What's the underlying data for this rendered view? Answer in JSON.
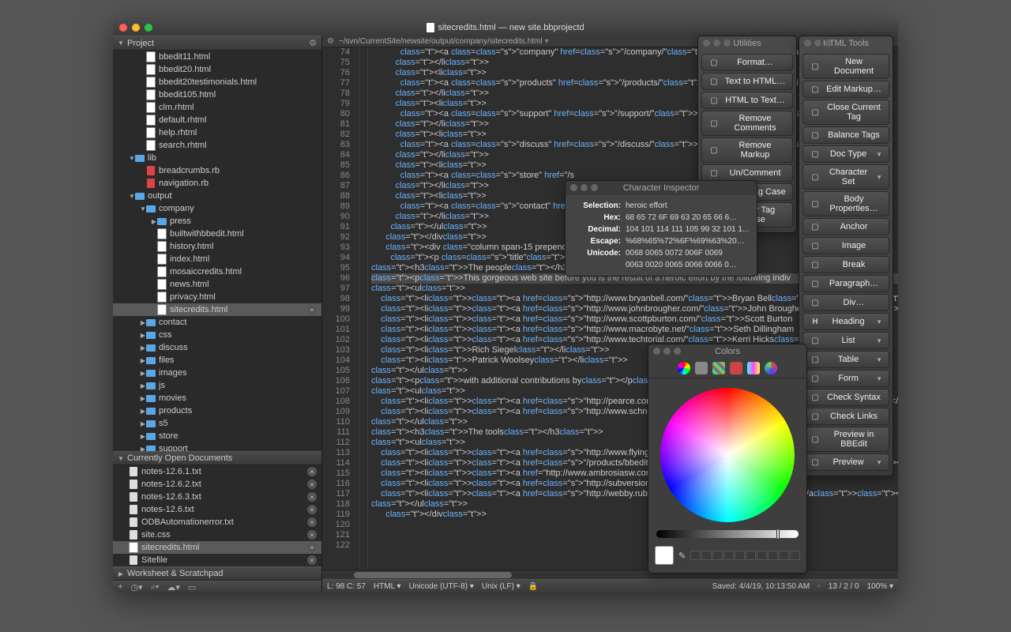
{
  "window": {
    "title": "sitecredits.html — new site.bbprojectd",
    "path": "~/svn/CurrentSite/newsite/output/company/sitecredits.html"
  },
  "sidebar": {
    "project_label": "Project",
    "open_docs_label": "Currently Open Documents",
    "worksheet_label": "Worksheet & Scratchpad",
    "project_tree": [
      {
        "name": "bbedit11.html",
        "icon": "html",
        "indent": 2
      },
      {
        "name": "bbedit20.html",
        "icon": "html",
        "indent": 2
      },
      {
        "name": "bbedit20testimonials.html",
        "icon": "html",
        "indent": 2
      },
      {
        "name": "bbedit105.html",
        "icon": "html",
        "indent": 2
      },
      {
        "name": "clm.rhtml",
        "icon": "html",
        "indent": 2
      },
      {
        "name": "default.rhtml",
        "icon": "html",
        "indent": 2
      },
      {
        "name": "help.rhtml",
        "icon": "html",
        "indent": 2
      },
      {
        "name": "search.rhtml",
        "icon": "html",
        "indent": 2
      },
      {
        "name": "lib",
        "icon": "folder",
        "indent": 1,
        "expand": "down"
      },
      {
        "name": "breadcrumbs.rb",
        "icon": "rb",
        "indent": 2
      },
      {
        "name": "navigation.rb",
        "icon": "rb",
        "indent": 2
      },
      {
        "name": "output",
        "icon": "folder",
        "indent": 1,
        "expand": "down"
      },
      {
        "name": "company",
        "icon": "folder",
        "indent": 2,
        "expand": "down"
      },
      {
        "name": "press",
        "icon": "folder",
        "indent": 3,
        "expand": "right"
      },
      {
        "name": "builtwithbbedit.html",
        "icon": "html",
        "indent": 3
      },
      {
        "name": "history.html",
        "icon": "html",
        "indent": 3
      },
      {
        "name": "index.html",
        "icon": "html",
        "indent": 3
      },
      {
        "name": "mosaiccredits.html",
        "icon": "html",
        "indent": 3
      },
      {
        "name": "news.html",
        "icon": "html",
        "indent": 3
      },
      {
        "name": "privacy.html",
        "icon": "html",
        "indent": 3
      },
      {
        "name": "sitecredits.html",
        "icon": "html",
        "indent": 3,
        "selected": true,
        "close": true
      },
      {
        "name": "contact",
        "icon": "folder",
        "indent": 2,
        "expand": "right"
      },
      {
        "name": "css",
        "icon": "folder",
        "indent": 2,
        "expand": "right"
      },
      {
        "name": "discuss",
        "icon": "folder",
        "indent": 2,
        "expand": "right"
      },
      {
        "name": "files",
        "icon": "folder",
        "indent": 2,
        "expand": "right"
      },
      {
        "name": "images",
        "icon": "folder",
        "indent": 2,
        "expand": "right"
      },
      {
        "name": "js",
        "icon": "folder",
        "indent": 2,
        "expand": "right"
      },
      {
        "name": "movies",
        "icon": "folder",
        "indent": 2,
        "expand": "right"
      },
      {
        "name": "products",
        "icon": "folder",
        "indent": 2,
        "expand": "right"
      },
      {
        "name": "s5",
        "icon": "folder",
        "indent": 2,
        "expand": "right"
      },
      {
        "name": "store",
        "icon": "folder",
        "indent": 2,
        "expand": "right"
      },
      {
        "name": "support",
        "icon": "folder",
        "indent": 2,
        "expand": "right"
      }
    ],
    "open_docs": [
      {
        "name": "notes-12.6.1.txt",
        "icon": "txt",
        "close": true
      },
      {
        "name": "notes-12.6.2.txt",
        "icon": "txt",
        "close": true
      },
      {
        "name": "notes-12.6.3.txt",
        "icon": "txt",
        "close": true
      },
      {
        "name": "notes-12.6.txt",
        "icon": "txt",
        "close": true
      },
      {
        "name": "ODBAutomationerror.txt",
        "icon": "txt",
        "close": true
      },
      {
        "name": "site.css",
        "icon": "txt",
        "close": true
      },
      {
        "name": "sitecredits.html",
        "icon": "html",
        "selected": true,
        "close": true
      },
      {
        "name": "Sitefile",
        "icon": "txt",
        "close": true
      }
    ]
  },
  "editor": {
    "first_line": 74,
    "lines": [
      "            <a class=\"company\" href=\"/company/\">Company</a>",
      "          </li>",
      "          <li>",
      "            <a class=\"products\" href=\"/products/\">Products</a>",
      "          </li>",
      "          <li>",
      "            <a class=\"support\" href=\"/support/\">Support</a>",
      "          </li>",
      "          <li>",
      "            <a class=\"discuss\" href=\"/discuss/\">Discuss</a>",
      "          </li>",
      "          <li>",
      "            <a class=\"store\" href=\"/s",
      "          </li>",
      "          <li>",
      "            <a class=\"contact\" href=\"",
      "          </li>",
      "        </ul>",
      "      </div>",
      "",
      "      <div class=\"column span-15 prepend-2 f",
      "",
      "        <p class=\"title\">Web Site Credits</",
      "<h3>The people</h3>",
      "<p>This gorgeous web site before you is the result of a heroic effort by the following indiv",
      "<ul>",
      "    <li><a href=\"http://www.bryanbell.com/\">Bryan Bell</a></li>",
      "    <li><a href=\"http://www.johnbrougher.com/\">John Brougher</a></li>",
      "    <li><a href=\"http://www.scottpburton.com/\">Scott Burton",
      "    <li><a href=\"http://www.macrobyte.net/\">Seth Dillingham",
      "    <li><a href=\"http://www.techtorial.com/\">Kerri Hicks</a",
      "    <li>Rich Siegel</li>",
      "    <li>Patrick Woolsey</li>",
      "</ul>",
      "<p>with additional contributions by</p>",
      "<ul>",
      "    <li><a href=\"http://pearce.com/\">Naomi Pearce</a></li>",
      "    <li><a href=\"http://www.schneibs.com/\">Sandra Schneible",
      "</ul>",
      "<h3>The tools</h3>",
      "<ul>",
      "    <li><a href=\"http://www.flyingmeat.com/acorn/\">Acorn</a",
      "    <li><a href=\"/products/bbedit/index.html\">BBEdit</a></li",
      "    <li><a href=\"http://www.ambrosiasw.com/utilities/snapzp",
      "    <li><a href=\"http://subversion.tigris.org/\">Subversion<",
      "    <li><a href=\"http://webby.rubyforge.org/\">Webby</a></li",
      "</ul>",
      "      </div>",
      ""
    ],
    "highlight_line_index": 24
  },
  "status": {
    "cursor": "L: 98 C: 57",
    "lang": "HTML",
    "encoding": "Unicode (UTF-8)",
    "lineend": "Unix (LF)",
    "saved": "Saved: 4/4/19, 10:13:50 AM",
    "counts": "13 / 2 / 0",
    "zoom": "100%"
  },
  "utilities": {
    "title": "Utilities",
    "items": [
      {
        "label": "Format…",
        "icon": "gear"
      },
      {
        "label": "Text to HTML…",
        "icon": "doc"
      },
      {
        "label": "HTML to Text…",
        "icon": "doc"
      },
      {
        "label": "Remove Comments",
        "icon": "comment"
      },
      {
        "label": "Remove Markup",
        "icon": "tag"
      },
      {
        "label": "Un/Comment",
        "icon": "comment"
      },
      {
        "label": "Raise Tag Case",
        "icon": "case"
      },
      {
        "label": "Lower Tag Case",
        "icon": "case"
      }
    ]
  },
  "htmltools": {
    "title": "HTML Tools",
    "items": [
      {
        "label": "New Document",
        "icon": "doc"
      },
      {
        "label": "Edit Markup…",
        "icon": "pencil"
      },
      {
        "label": "Close Current Tag",
        "icon": "tag"
      },
      {
        "label": "Balance Tags",
        "icon": "balance"
      },
      {
        "label": "Doc Type",
        "icon": "doc",
        "menu": true
      },
      {
        "label": "Character Set",
        "icon": "char",
        "menu": true
      },
      {
        "label": "Body Properties…",
        "icon": "body"
      },
      {
        "label": "Anchor",
        "icon": "anchor"
      },
      {
        "label": "Image",
        "icon": "image"
      },
      {
        "label": "Break",
        "icon": "break"
      },
      {
        "label": "Paragraph…",
        "icon": "para"
      },
      {
        "label": "Div…",
        "icon": "div"
      },
      {
        "label": "Heading",
        "icon": "H",
        "menu": true
      },
      {
        "label": "List",
        "icon": "list",
        "menu": true
      },
      {
        "label": "Table",
        "icon": "table",
        "menu": true
      },
      {
        "label": "Form",
        "icon": "form",
        "menu": true
      },
      {
        "label": "Check Syntax",
        "icon": "check"
      },
      {
        "label": "Check Links",
        "icon": "link"
      },
      {
        "label": "Preview in BBEdit",
        "icon": "eye"
      },
      {
        "label": "Preview",
        "icon": "eye",
        "menu": true
      }
    ]
  },
  "char_inspector": {
    "title": "Character Inspector",
    "rows": [
      {
        "label": "Selection:",
        "value": "heroic effort"
      },
      {
        "label": "Hex:",
        "value": "68 65 72 6F 69 63 20 65 66 6…"
      },
      {
        "label": "Decimal:",
        "value": "104 101 114 111 105 99 32 101 1…"
      },
      {
        "label": "Escape:",
        "value": "%68%65%72%6F%69%63%20…"
      },
      {
        "label": "Unicode:",
        "value": "0068 0065 0072 006F 0069"
      },
      {
        "label": "",
        "value": "0063 0020 0065 0066 0066 0…"
      }
    ]
  },
  "colors": {
    "title": "Colors"
  }
}
